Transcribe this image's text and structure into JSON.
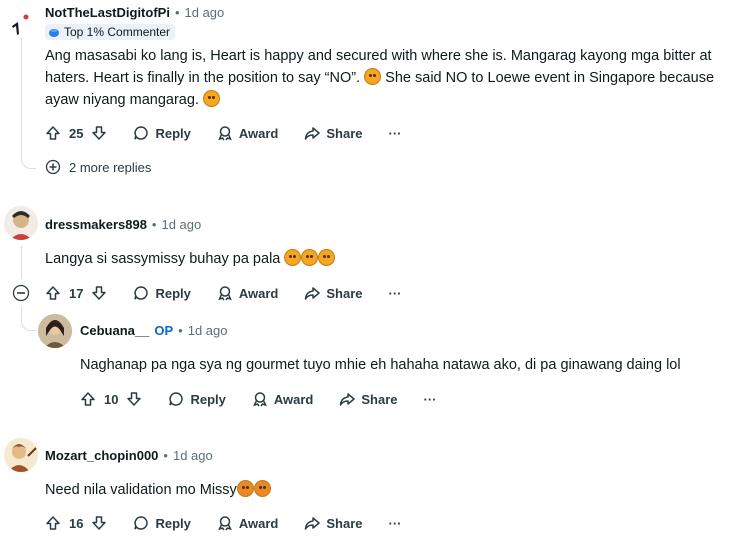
{
  "comments": [
    {
      "username": "NotTheLastDigitofPi",
      "time": "1d ago",
      "badge": "Top 1% Commenter",
      "body": [
        "Ang masasabi ko lang is, Heart is happy and secured with where she is. Mangarag kayong mga bitter at",
        "haters. Heart is finally in the position to say “NO”.",
        "She said NO to Loewe event in Singapore because",
        "ayaw niyang mangarag."
      ],
      "votes": "25",
      "more_replies": "2 more replies"
    },
    {
      "username": "dressmakers898",
      "time": "1d ago",
      "body": "Langya si sassymissy buhay pa pala",
      "votes": "17"
    },
    {
      "username": "Cebuana__",
      "op": "OP",
      "time": "1d ago",
      "body": "Naghanap pa nga sya ng gourmet tuyo mhie eh hahaha natawa ako, di pa ginawang daing lol",
      "votes": "10"
    },
    {
      "username": "Mozart_chopin000",
      "time": "1d ago",
      "body": "Need nila validation mo Missy",
      "votes": "16"
    }
  ],
  "actions": {
    "reply": "Reply",
    "award": "Award",
    "share": "Share",
    "more": "···"
  },
  "separator": "•",
  "colors": {
    "op": "#0a66d8",
    "badge_bg": "#eaf1fb",
    "thread_line": "#d6dde0"
  }
}
